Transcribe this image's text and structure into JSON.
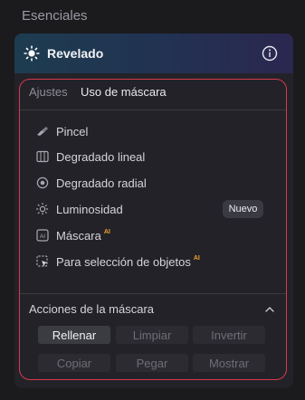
{
  "section": {
    "title": "Esenciales"
  },
  "header": {
    "title": "Revelado",
    "icon": "sun-icon",
    "info_icon": "info-icon"
  },
  "tabs": [
    {
      "label": "Ajustes",
      "active": false
    },
    {
      "label": "Uso de máscara",
      "active": true
    }
  ],
  "tools": [
    {
      "label": "Pincel",
      "icon": "brush-icon",
      "ai": ""
    },
    {
      "label": "Degradado lineal",
      "icon": "linear-gradient-icon",
      "ai": ""
    },
    {
      "label": "Degradado radial",
      "icon": "radial-gradient-icon",
      "ai": ""
    },
    {
      "label": "Luminosidad",
      "icon": "luminosity-icon",
      "ai": ""
    },
    {
      "label": "Máscara",
      "icon": "ai-mask-icon",
      "ai": "AI"
    },
    {
      "label": "Para selección de objetos",
      "icon": "object-selection-icon",
      "ai": "AI"
    }
  ],
  "badge": {
    "nuevo": "Nuevo"
  },
  "actions": {
    "title": "Acciones de la máscara",
    "buttons": [
      {
        "label": "Rellenar",
        "enabled": true
      },
      {
        "label": "Limpiar",
        "enabled": false
      },
      {
        "label": "Invertir",
        "enabled": false
      },
      {
        "label": "Copiar",
        "enabled": false
      },
      {
        "label": "Pegar",
        "enabled": false
      },
      {
        "label": "Mostrar",
        "enabled": false
      }
    ]
  },
  "colors": {
    "highlight_outline": "#d63a4a",
    "ai_badge": "#f0a030",
    "header_gradient_start": "#1e3c4f",
    "header_gradient_end": "#2b2750"
  }
}
